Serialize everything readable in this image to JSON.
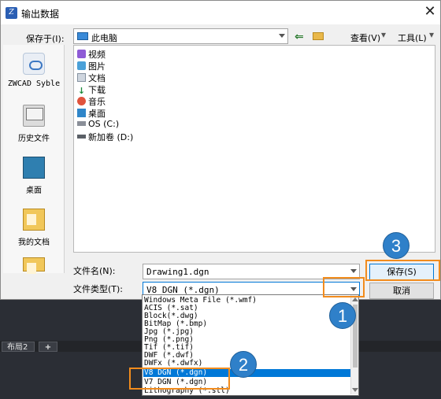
{
  "dialog": {
    "title": "输出数据",
    "close_glyph": "✕"
  },
  "toolbar": {
    "save_in_label": "保存于(I):",
    "location": "此电脑",
    "back_glyph": "⇐",
    "view_label": "查看(V)",
    "tools_label": "工具(L)",
    "chevron_glyph": "▾"
  },
  "places": [
    {
      "label": "ZWCAD Syble",
      "icon": "cloud-icon"
    },
    {
      "label": "历史文件",
      "icon": "history-icon"
    },
    {
      "label": "桌面",
      "icon": "desktop-icon"
    },
    {
      "label": "我的文档",
      "icon": "documents-icon"
    }
  ],
  "files": [
    {
      "label": "视频",
      "icon": "video-folder-icon"
    },
    {
      "label": "图片",
      "icon": "image-folder-icon"
    },
    {
      "label": "文档",
      "icon": "document-folder-icon"
    },
    {
      "label": "下载",
      "icon": "download-folder-icon",
      "glyph": "↓"
    },
    {
      "label": "音乐",
      "icon": "music-folder-icon"
    },
    {
      "label": "桌面",
      "icon": "desktop-folder-icon"
    },
    {
      "label": "OS (C:)",
      "icon": "drive-icon"
    },
    {
      "label": "新加卷 (D:)",
      "icon": "drive-icon"
    }
  ],
  "form": {
    "filename_label": "文件名(N):",
    "filename_value": "Drawing1.dgn",
    "filetype_label": "文件类型(T):",
    "filetype_value": "V8 DGN (*.dgn)"
  },
  "buttons": {
    "save": "保存(S)",
    "cancel": "取消"
  },
  "filetype_options": [
    "Windows Meta File (*.wmf)",
    "ACIS (*.sat)",
    "Block(*.dwg)",
    "BitMap (*.bmp)",
    "Jpg (*.jpg)",
    "Png (*.png)",
    "Tif (*.tif)",
    "DWF (*.dwf)",
    "DWFx (*.dwfx)",
    "V8 DGN (*.dgn)",
    "V7 DGN (*.dgn)",
    "Lithography (*.stl)"
  ],
  "selected_option_index": 9,
  "background_app": {
    "layout_tab": "布局2",
    "add_tab": "+"
  },
  "annotations": [
    "1",
    "2",
    "3"
  ],
  "colors": {
    "highlight": "#f28c1d",
    "badge": "#2f80c9",
    "selection": "#0078d7"
  }
}
